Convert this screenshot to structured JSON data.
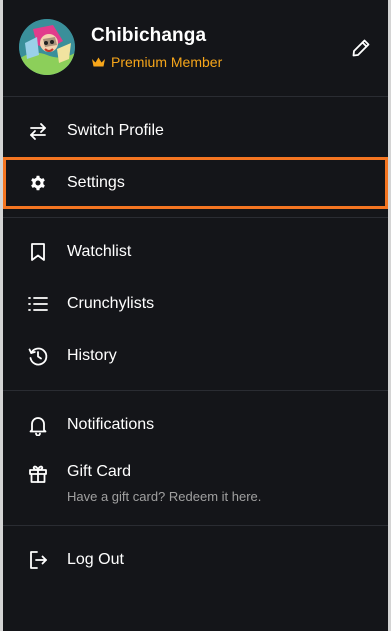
{
  "profile": {
    "name": "Chibichanga",
    "membership": "Premium Member",
    "avatar_icon": "profile-avatar",
    "edit_icon": "pencil-icon"
  },
  "menu": {
    "section1": [
      {
        "label": "Switch Profile",
        "icon": "switch-arrows-icon"
      },
      {
        "label": "Settings",
        "icon": "gear-icon",
        "selected": true
      }
    ],
    "section2": [
      {
        "label": "Watchlist",
        "icon": "bookmark-icon"
      },
      {
        "label": "Crunchylists",
        "icon": "list-icon"
      },
      {
        "label": "History",
        "icon": "history-icon"
      }
    ],
    "section3": [
      {
        "label": "Notifications",
        "icon": "bell-icon"
      },
      {
        "label": "Gift Card",
        "sublabel": "Have a gift card? Redeem it here.",
        "icon": "gift-icon"
      }
    ],
    "section4": [
      {
        "label": "Log Out",
        "icon": "logout-icon"
      }
    ]
  },
  "colors": {
    "background": "#141519",
    "divider": "#2a2c32",
    "accent": "#f47521",
    "premium": "#f7a61a",
    "text": "#ffffff",
    "subtext": "#a0a0a0"
  }
}
